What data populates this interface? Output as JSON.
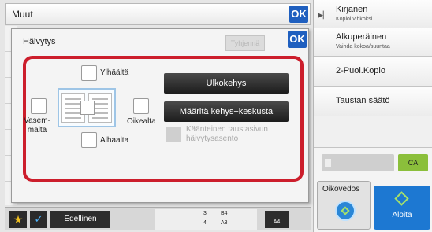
{
  "topbar": {
    "title": "Muut",
    "ok_label": "OK"
  },
  "right_panel": {
    "items": [
      {
        "label": "Kirjanen",
        "sub": "Kopioi vihkoksi"
      },
      {
        "label": "Alkuperäinen",
        "sub": "Vaihda kokoa/suuntaa"
      },
      {
        "label": "2-Puol.Kopio",
        "sub": ""
      },
      {
        "label": "Taustan säätö",
        "sub": ""
      }
    ],
    "ca_label": "CA",
    "oikovedos_label": "Oikovedos",
    "aloita_label": "Aloita"
  },
  "dialog": {
    "title": "Häivytys",
    "ok_label": "OK",
    "clear_label": "Tyhjennä",
    "top_label": "Ylhäältä",
    "left_label": "Vasem-\nmalta",
    "right_label": "Oikealta",
    "bottom_label": "Alhaalta",
    "frame_button": "Ulkokehys",
    "frame_center_button": "Määritä kehys+keskusta",
    "reverse_label": "Käänteinen taustasivun häivytysasento"
  },
  "bottombar": {
    "previous_label": "Edellinen",
    "tray": [
      {
        "num": "3",
        "size": "B4"
      },
      {
        "num": "4",
        "size": "A3"
      }
    ],
    "paper_size": "A4"
  },
  "colors": {
    "frame_red": "#cc1e2c",
    "ok_blue": "#1f5fbf",
    "ca_green": "#8bbf3b",
    "start_blue": "#1d78d2"
  }
}
